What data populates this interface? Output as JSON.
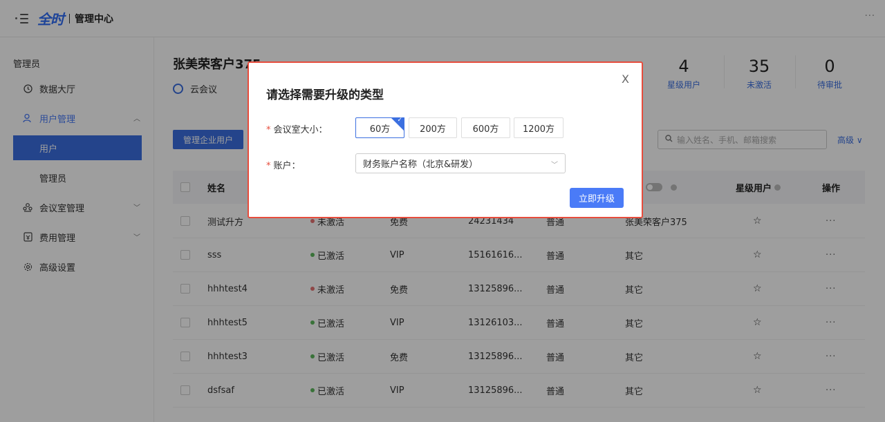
{
  "header": {
    "logo_text": "全时",
    "app_title": "管理中心",
    "more": "···"
  },
  "sidebar": {
    "section_label": "管理员",
    "items": [
      {
        "label": "数据大厅"
      },
      {
        "label": "用户管理"
      },
      {
        "label": "用户"
      },
      {
        "label": "管理员"
      },
      {
        "label": "会议室管理"
      },
      {
        "label": "费用管理"
      },
      {
        "label": "高级设置"
      }
    ]
  },
  "main": {
    "customer_name": "张美荣客户375",
    "meeting_label": "云会议",
    "stats": [
      {
        "num": "4",
        "label": "星级用户"
      },
      {
        "num": "35",
        "label": "未激活"
      },
      {
        "num": "0",
        "label": "待审批"
      }
    ],
    "manage_button": "管理企业用户",
    "search_placeholder": "输入姓名、手机、邮箱搜索",
    "advanced": "高级",
    "advanced_chevron": "∨"
  },
  "table": {
    "headers": {
      "name": "姓名",
      "star": "星级用户",
      "op": "操作"
    },
    "rows": [
      {
        "name": "测试升方",
        "status": "未激活",
        "status_color": "#e57373",
        "plan": "免费",
        "phone": "24231434",
        "level": "普通",
        "org": "张美荣客户375"
      },
      {
        "name": "sss",
        "status": "已激活",
        "status_color": "#5cb85c",
        "plan": "VIP",
        "phone": "15161616...",
        "level": "普通",
        "org": "其它"
      },
      {
        "name": "hhhtest4",
        "status": "未激活",
        "status_color": "#e57373",
        "plan": "免费",
        "phone": "13125896...",
        "level": "普通",
        "org": "其它"
      },
      {
        "name": "hhhtest5",
        "status": "已激活",
        "status_color": "#5cb85c",
        "plan": "VIP",
        "phone": "13126103...",
        "level": "普通",
        "org": "其它"
      },
      {
        "name": "hhhtest3",
        "status": "已激活",
        "status_color": "#5cb85c",
        "plan": "免费",
        "phone": "13125896...",
        "level": "普通",
        "org": "其它"
      },
      {
        "name": "dsfsaf",
        "status": "已激活",
        "status_color": "#5cb85c",
        "plan": "VIP",
        "phone": "13125896...",
        "level": "普通",
        "org": "其它"
      }
    ],
    "star_glyph": "☆",
    "op_glyph": "···"
  },
  "modal": {
    "title": "请选择需要升级的类型",
    "close": "X",
    "room_size_label": "会议室大小：",
    "sizes": [
      "60方",
      "200方",
      "600方",
      "1200方"
    ],
    "selected_size": "60方",
    "account_label": "账户：",
    "account_value": "财务账户名称（北京&研发）",
    "upgrade_button": "立即升级",
    "required_mark": "*"
  },
  "colors": {
    "primary": "#3b6fe0",
    "modal_border": "#e74c3c",
    "active_green": "#5cb85c",
    "inactive_red": "#e57373"
  }
}
